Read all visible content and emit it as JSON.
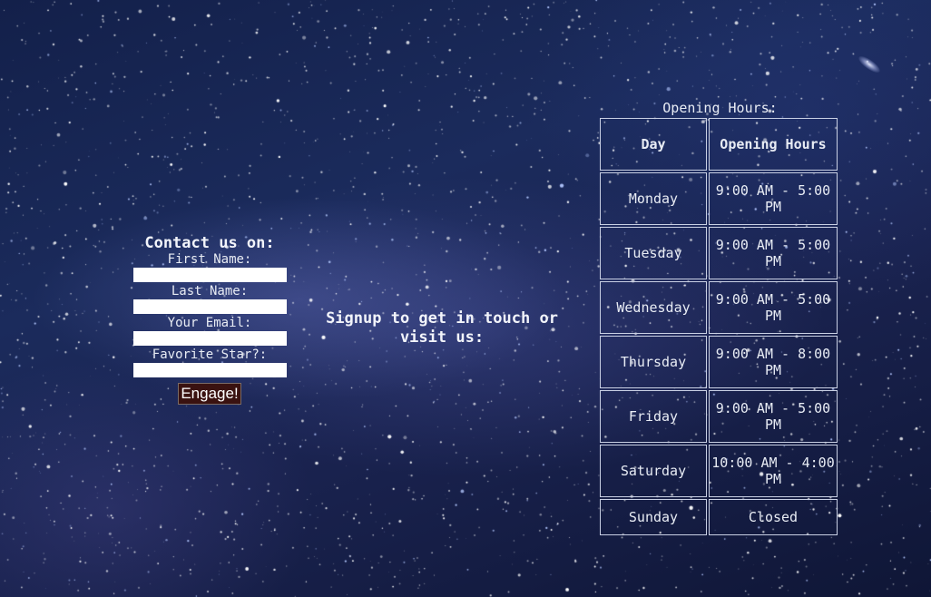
{
  "contact": {
    "title": "Contact us on:",
    "fields": [
      {
        "label": "First Name:",
        "value": ""
      },
      {
        "label": "Last Name:",
        "value": ""
      },
      {
        "label": "Your Email:",
        "value": ""
      },
      {
        "label": "Favorite Star?:",
        "value": ""
      }
    ],
    "submit_label": "Engage!"
  },
  "signup": {
    "text": "Signup to get in touch or visit us:"
  },
  "hours": {
    "caption": "Opening Hours:",
    "headers": [
      "Day",
      "Opening Hours"
    ],
    "rows": [
      {
        "day": "Monday",
        "time": "9:00 AM - 5:00 PM"
      },
      {
        "day": "Tuesday",
        "time": "9:00 AM - 5:00 PM"
      },
      {
        "day": "Wednesday",
        "time": "9:00 AM - 5:00 PM"
      },
      {
        "day": "Thursday",
        "time": "9:00 AM - 8:00 PM"
      },
      {
        "day": "Friday",
        "time": "9:00 AM - 5:00 PM"
      },
      {
        "day": "Saturday",
        "time": "10:00 AM - 4:00 PM"
      },
      {
        "day": "Sunday",
        "time": "Closed"
      }
    ]
  },
  "colors": {
    "background": "#1b2b5c",
    "text": "#e8ecf4",
    "button_bg": "#3a1210",
    "border": "#c9d0e4"
  }
}
